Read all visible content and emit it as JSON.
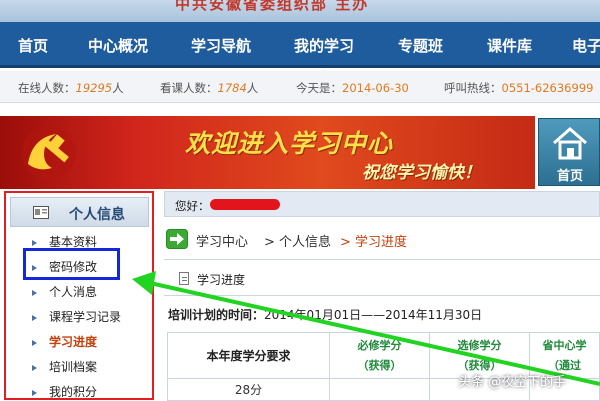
{
  "banner": {
    "title": "中共安徽省委组织部 主办"
  },
  "nav": {
    "items": [
      "首页",
      "中心概况",
      "学习导航",
      "我的学习",
      "专题班",
      "课件库",
      "电子"
    ],
    "active_index": 3
  },
  "status": {
    "online_label": "在线人数：",
    "online_count": "19295",
    "online_unit": "人",
    "viewing_label": "看课人数：",
    "viewing_count": "1784",
    "viewing_unit": "人",
    "date_label": "今天是：",
    "date": "2014-06-30",
    "hotline_label": "呼叫热线：",
    "hotline": "0551-62636999"
  },
  "welcome": {
    "line1": "欢迎进入学习中心",
    "line2": "祝您学习愉快！",
    "home_label": "首页"
  },
  "sidebar": {
    "title": "个人信息",
    "items": [
      "基本资料",
      "密码修改",
      "个人消息",
      "课程学习记录",
      "学习进度",
      "培训档案",
      "我的积分"
    ],
    "active_index": 4
  },
  "content": {
    "greeting": "您好：",
    "breadcrumb": [
      "学习中心",
      "> 个人信息",
      "> 学习进度"
    ],
    "section_title": "学习进度",
    "plan_label": "培训计划的时间：",
    "plan_range": "2014年01月01日——2014年11月30日",
    "table": {
      "row_header": "本年度学分要求",
      "col_required": "必修学分",
      "col_required_sub": "（获得）",
      "col_elective": "选修学分",
      "col_elective_sub": "（获得）",
      "col_province": "省中心学",
      "col_province_sub": "（通过",
      "value_total": "28分"
    }
  },
  "watermark": "头条 @夜空下的手",
  "colors": {
    "nav_bg": "#1f5c9d",
    "highlight_orange": "#e07a1f",
    "annotation_red": "#e02020",
    "annotation_blue": "#1528d6",
    "annotation_green": "#22d422"
  }
}
